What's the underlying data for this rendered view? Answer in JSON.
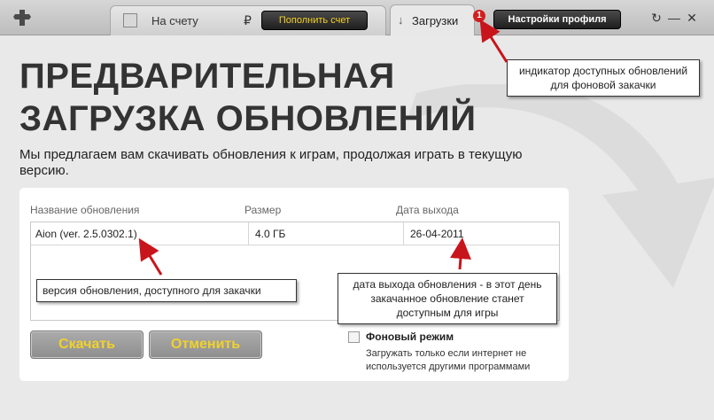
{
  "topbar": {
    "balance_label": "На счету",
    "currency_symbol": "₽",
    "topup_label": "Пополнить счет",
    "downloads_tab": "Загрузки",
    "updates_badge": "1",
    "profile_label": "Настройки профиля",
    "icons": [
      "puzzle-logo-icon",
      "runner-icon",
      "download-arrow-icon",
      "refresh-icon",
      "minimize-icon",
      "close-icon"
    ],
    "refresh_glyph": "↻",
    "minimize_glyph": "—",
    "close_glyph": "✕"
  },
  "main": {
    "title": "ПРЕДВАРИТЕЛЬНАЯ ЗАГРУЗКА ОБНОВЛЕНИЙ",
    "subtitle": "Мы предлагаем вам скачивать обновления к играм, продолжая играть в текущую версию.",
    "table": {
      "columns": [
        "Название обновления",
        "Размер",
        "Дата выхода"
      ],
      "rows": [
        {
          "name": "Aion (ver. 2.5.0302.1)",
          "size": "4.0 ГБ",
          "date": "26-04-2011"
        }
      ]
    },
    "download_button": "Скачать",
    "cancel_button": "Отменить",
    "background_mode": {
      "label": "Фоновый режим",
      "description": "Загружать только если интернет не используется другими программами",
      "checked": false
    }
  },
  "callouts": {
    "badge_note": "индикатор доступных обновлений для фоновой закачки",
    "version_note": "версия обновления, доступного для закачки",
    "date_note": "дата выхода обновления - в этот день закачанное обновление станет доступным для игры"
  },
  "colors": {
    "accent_yellow": "#f0d12c",
    "badge_red": "#d21f1f",
    "annotation_arrow": "#c8151b"
  }
}
